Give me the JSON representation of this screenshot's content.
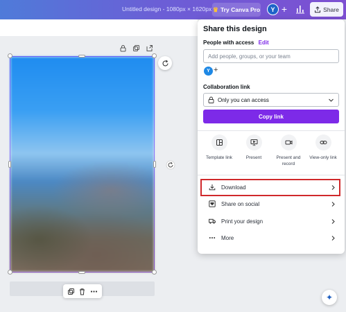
{
  "topbar": {
    "doc_title": "Untitled design - 1080px × 1620px",
    "try_pro_label": "Try Canva Pro",
    "avatar_initial": "Y",
    "share_label": "Share"
  },
  "share_panel": {
    "title": "Share this design",
    "people_label": "People with access",
    "people_edit": "Edit",
    "add_people_placeholder": "Add people, groups, or your team",
    "avatar_initial": "Y",
    "collab_label": "Collaboration link",
    "access_value": "Only you can access",
    "copy_link_label": "Copy link",
    "options": [
      {
        "label": "Template link",
        "icon": "template-icon"
      },
      {
        "label": "Present",
        "icon": "present-icon"
      },
      {
        "label": "Present and record",
        "icon": "record-icon"
      },
      {
        "label": "View-only link",
        "icon": "link-icon"
      }
    ],
    "menu": [
      {
        "label": "Download",
        "icon": "download-icon"
      },
      {
        "label": "Share on social",
        "icon": "heart-icon"
      },
      {
        "label": "Print your design",
        "icon": "truck-icon"
      },
      {
        "label": "More",
        "icon": "more-icon"
      }
    ]
  },
  "colors": {
    "accent": "#7d2ae8",
    "highlight": "#d0282b",
    "selection": "#8b3dff"
  }
}
